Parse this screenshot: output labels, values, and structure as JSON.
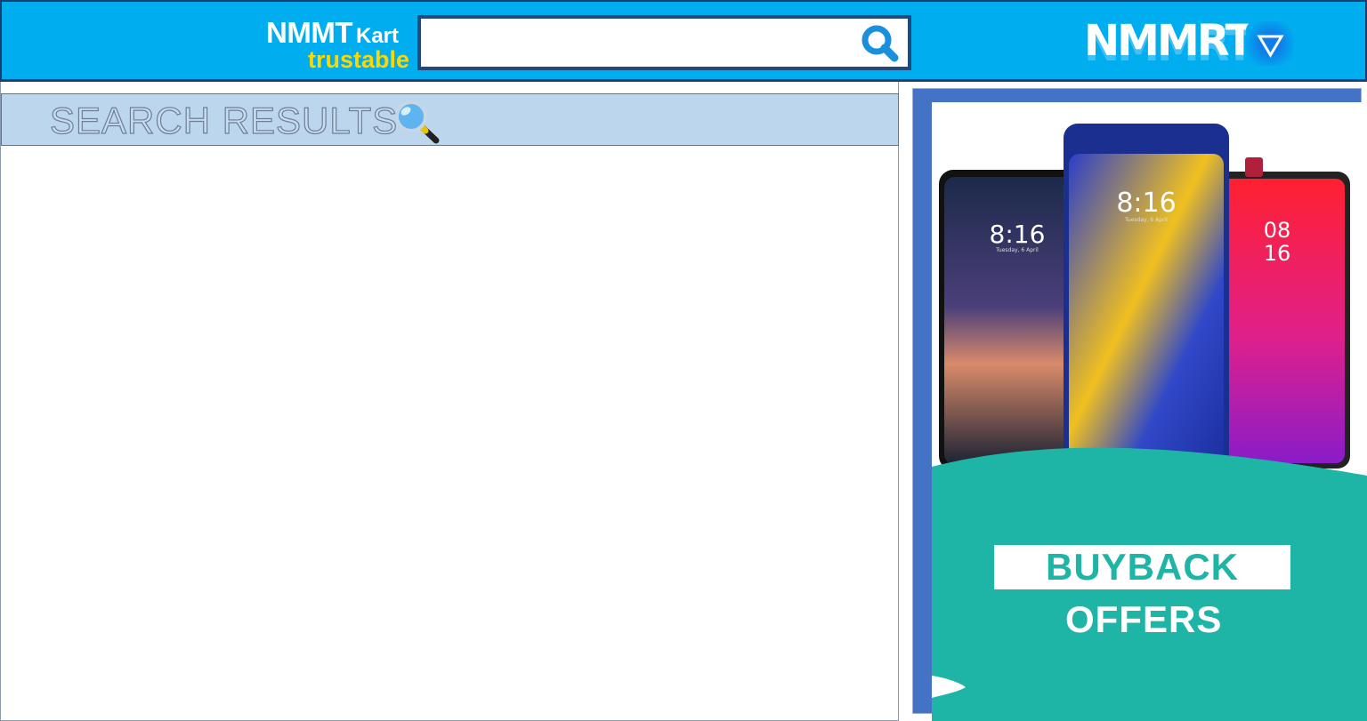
{
  "header": {
    "brand_name": "NMMT",
    "brand_suffix": "Kart",
    "brand_tagline": "trustable",
    "search": {
      "value": "",
      "placeholder": ""
    },
    "search_icon": "search-icon",
    "logo_text": "NMMRT",
    "menu_icon": "triangle-down-icon"
  },
  "results": {
    "title": "SEARCH RESULTS",
    "title_icon": "magnifier-icon",
    "items": []
  },
  "ad": {
    "phones": [
      {
        "clock": "8:16",
        "date": "Tuesday, 6 April"
      },
      {
        "clock": "8:16",
        "date": "Tuesday, 6 April"
      },
      {
        "clock_hours": "08",
        "clock_minutes": "16"
      }
    ],
    "headline": "BUYBACK",
    "subheadline": "OFFERS"
  },
  "colors": {
    "header_bg": "#00adef",
    "tagline": "#ffd700",
    "results_header_bg": "#bcd6ee",
    "ad_frame": "#4472c4",
    "ad_teal": "#1fb5a6"
  }
}
